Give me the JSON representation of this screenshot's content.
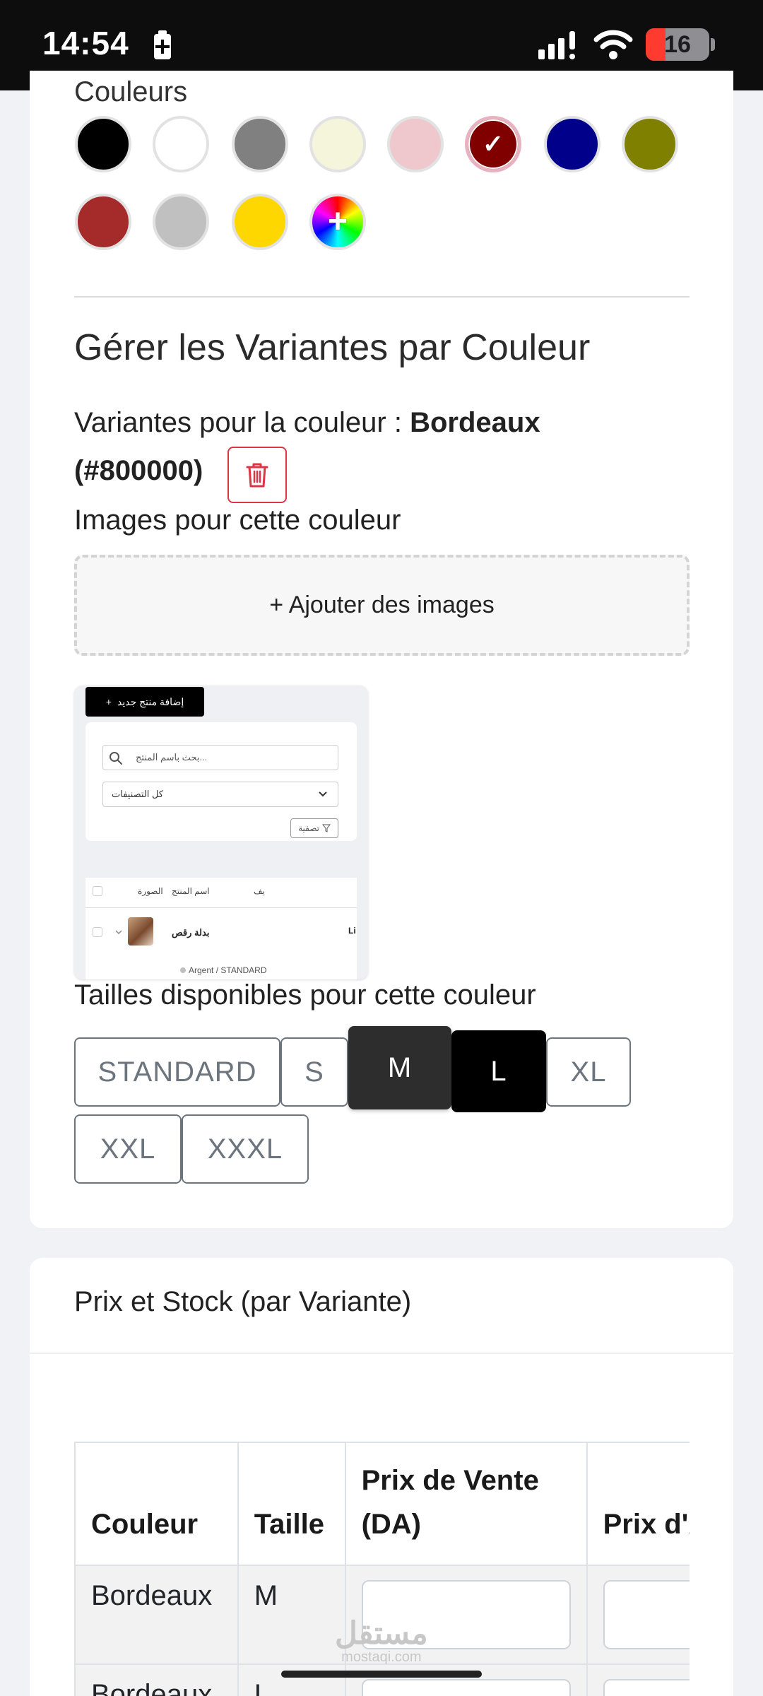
{
  "status_bar": {
    "time": "14:54",
    "battery_level": "16"
  },
  "colors_section": {
    "label": "Couleurs",
    "swatches": [
      {
        "name": "black",
        "hex": "#000000"
      },
      {
        "name": "white",
        "hex": "#ffffff"
      },
      {
        "name": "gray",
        "hex": "#808080"
      },
      {
        "name": "beige",
        "hex": "#f5f5dc"
      },
      {
        "name": "pink",
        "hex": "#eec8cc"
      },
      {
        "name": "bordeaux",
        "hex": "#800000",
        "selected": true
      },
      {
        "name": "navy",
        "hex": "#00008b"
      },
      {
        "name": "olive",
        "hex": "#808000"
      },
      {
        "name": "red",
        "hex": "#a52a2a"
      },
      {
        "name": "silver",
        "hex": "#c0c0c0"
      },
      {
        "name": "yellow",
        "hex": "#ffd700"
      }
    ],
    "custom_swatch_glyph": "+",
    "selected_check": "✓"
  },
  "variants": {
    "title": "Gérer les Variantes par Couleur",
    "prefix": "Variantes pour la couleur : ",
    "color_name": "Bordeaux",
    "color_hex": "(#800000)",
    "images_label": "Images pour cette couleur",
    "add_images_label": "+ Ajouter des images"
  },
  "thumbnail": {
    "add_product_label": "إضافة منتج جديد",
    "search_placeholder": "بحث باسم المنتج...",
    "category_select": "كل التصنيفات",
    "filter_label": "تصفية",
    "col_name": "اسم المنتج",
    "col_image": "الصورة",
    "col_partial": "يف",
    "row_name": "بدلة رقص",
    "row_tag": "Li",
    "breadcrumb_color": "Argent",
    "breadcrumb_sep": "/",
    "breadcrumb_size": "STANDARD"
  },
  "sizes": {
    "label": "Tailles disponibles pour cette couleur",
    "options": [
      {
        "label": "STANDARD",
        "state": "default"
      },
      {
        "label": "S",
        "state": "default"
      },
      {
        "label": "M",
        "state": "hover"
      },
      {
        "label": "L",
        "state": "active"
      },
      {
        "label": "XL",
        "state": "default"
      },
      {
        "label": "XXL",
        "state": "default"
      },
      {
        "label": "XXXL",
        "state": "default"
      }
    ]
  },
  "price_stock": {
    "title": "Prix et Stock (par Variante)",
    "columns": [
      "Couleur",
      "Taille",
      "Prix de Vente (DA)",
      "Prix d'Achat (DA)"
    ],
    "rows": [
      {
        "couleur": "Bordeaux",
        "taille": "M",
        "prix_vente": "",
        "prix_achat": ""
      },
      {
        "couleur": "Bordeaux",
        "taille": "L",
        "prix_vente": "",
        "prix_achat": ""
      }
    ]
  },
  "watermark": {
    "arabic": "مستقل",
    "url": "mostaqi.com"
  },
  "colors": {
    "danger": "#dc3545",
    "active_size": "#000000",
    "hover_size": "#2d2d2d"
  }
}
